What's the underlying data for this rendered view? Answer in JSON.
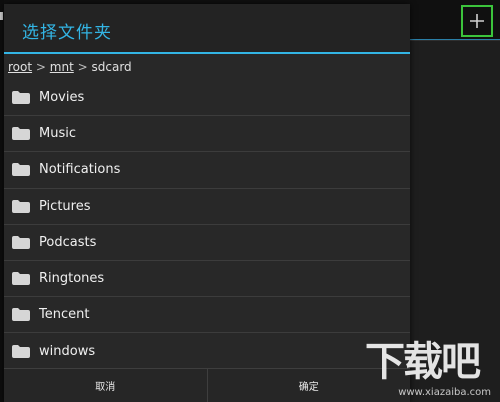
{
  "dialog": {
    "title": "选择文件夹",
    "breadcrumb": [
      {
        "label": "root",
        "link": true
      },
      {
        "label": "mnt",
        "link": true
      },
      {
        "label": "sdcard",
        "link": false
      }
    ],
    "breadcrumb_separator": ">",
    "folders": [
      "Movies",
      "Music",
      "Notifications",
      "Pictures",
      "Podcasts",
      "Ringtones",
      "Tencent",
      "windows"
    ],
    "cancel_label": "取消",
    "confirm_label": "确定"
  },
  "actionbar": {
    "add_icon": "plus-icon"
  },
  "watermark": {
    "logo": "下载吧",
    "url": "www.xiazaiba.com"
  },
  "colors": {
    "accent": "#33b5e5",
    "highlight": "#3cc43c",
    "dialog_bg": "#282828",
    "screen_bg": "#1b1b1b"
  }
}
